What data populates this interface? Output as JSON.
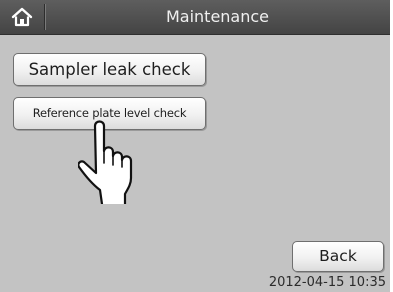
{
  "header": {
    "title": "Maintenance",
    "home_icon": "home-icon"
  },
  "menu": {
    "sampler_leak_check_label": "Sampler leak check",
    "reference_plate_level_check_label": "Reference plate level check"
  },
  "footer": {
    "back_label": "Back",
    "datetime": "2012-04-15 10:35"
  },
  "overlay": {
    "pointer_icon": "pointing-hand-icon"
  },
  "colors": {
    "screen_background": "#c3c3c3",
    "titlebar": "#4f4f4f",
    "button_face": "#f4f4f4",
    "text": "#1e1e1e"
  }
}
